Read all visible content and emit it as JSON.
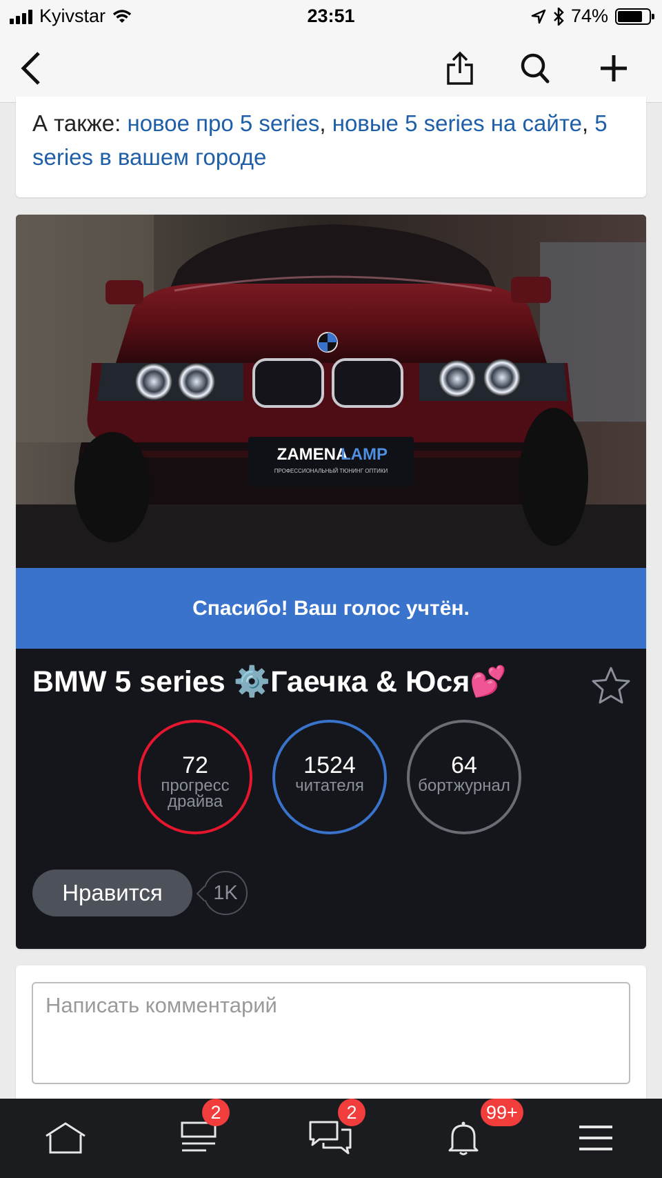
{
  "status": {
    "carrier": "Kyivstar",
    "time": "23:51",
    "battery": "74%"
  },
  "nav": {
    "back": "back",
    "share": "share",
    "search": "search",
    "add": "add"
  },
  "also": {
    "prefix": "А также:",
    "links": [
      "новое про 5 series",
      "новые 5 series на сайте",
      "5 series в вашем городе"
    ]
  },
  "car": {
    "plate_brand_a": "ZAMENA",
    "plate_brand_b": "LAMP",
    "plate_sub": "ПРОФЕССИОНАЛЬНЫЙ ТЮНИНГ ОПТИКИ",
    "thanks": "Спасибо! Ваш голос учтён.",
    "title": "BMW 5 series ⚙️Гаечка & Юся💕",
    "stats": [
      {
        "value": "72",
        "label": "прогресс драйва",
        "color": "#e5162d"
      },
      {
        "value": "1524",
        "label": "читателя",
        "color": "#3a73cc"
      },
      {
        "value": "64",
        "label": "бортжурнал",
        "color": "#6a6d73"
      }
    ],
    "like_label": "Нравится",
    "like_count": "1K"
  },
  "comment": {
    "placeholder": "Написать комментарий"
  },
  "tabs": [
    {
      "icon": "home-icon"
    },
    {
      "icon": "feed-icon",
      "badge": "2"
    },
    {
      "icon": "messages-icon",
      "badge": "2"
    },
    {
      "icon": "bell-icon",
      "badge": "99+"
    },
    {
      "icon": "menu-icon"
    }
  ]
}
